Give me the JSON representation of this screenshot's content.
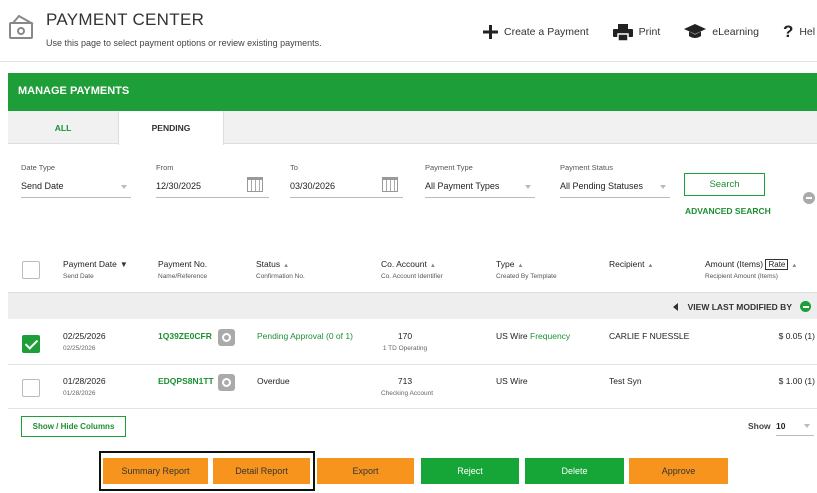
{
  "header": {
    "title": "PAYMENT CENTER",
    "subtitle": "Use this page to select payment options or review existing payments.",
    "actions": [
      {
        "label": "Create a Payment",
        "icon": "plus-icon"
      },
      {
        "label": "Print",
        "icon": "printer-icon"
      },
      {
        "label": "eLearning",
        "icon": "graduation-cap-icon"
      },
      {
        "label": "Hel",
        "icon": "help-icon"
      }
    ]
  },
  "section_title": "MANAGE PAYMENTS",
  "tabs": [
    {
      "label": "ALL",
      "active": false
    },
    {
      "label": "PENDING",
      "active": true
    }
  ],
  "filters": {
    "date_type": {
      "label": "Date Type",
      "value": "Send Date"
    },
    "from": {
      "label": "From",
      "value": "12/30/2025"
    },
    "to": {
      "label": "To",
      "value": "03/30/2026"
    },
    "payment_type": {
      "label": "Payment Type",
      "value": "All Payment Types"
    },
    "payment_status": {
      "label": "Payment Status",
      "value": "All Pending Statuses"
    },
    "search_label": "Search",
    "advanced_search": "ADVANCED SEARCH"
  },
  "columns": [
    {
      "title": "Payment Date",
      "sub": "Send Date",
      "sort": "down"
    },
    {
      "title": "Payment No.",
      "sub": "Name/Reference",
      "sort": ""
    },
    {
      "title": "Status",
      "sub": "Confirmation No.",
      "sort": "up"
    },
    {
      "title": "Co. Account",
      "sub": "Co. Account Identifier",
      "sort": "up"
    },
    {
      "title": "Type",
      "sub": "Created By Template",
      "sort": "up"
    },
    {
      "title": "Recipient",
      "sub": "",
      "sort": "up"
    },
    {
      "title": "Amount (Items)",
      "sub": "Recipient Amount (Items)",
      "sort": "up",
      "extra": "Rate"
    }
  ],
  "view_last_modified": "VIEW LAST MODIFIED BY",
  "rows": [
    {
      "checked": true,
      "date": "02/25/2026",
      "date_sub": "02/25/2026",
      "payment_no": "1Q39ZE0CFR",
      "status": "Pending Approval (0 of 1)",
      "account": "170",
      "account_sub": "1 TD Operating",
      "type": "US Wire",
      "type_link": "Frequency",
      "recipient": "CARLIE F NUESSLE",
      "amount": "$ 0.05 (1)"
    },
    {
      "checked": false,
      "date": "01/28/2026",
      "date_sub": "01/28/2026",
      "payment_no": "EDQPS8N1TT",
      "status": "Overdue",
      "account": "713",
      "account_sub": "Checking Account",
      "type": "US Wire",
      "type_link": "",
      "recipient": "Test Syn",
      "amount": "$ 1.00 (1)"
    }
  ],
  "show_hide_columns": "Show / Hide Columns",
  "page_size": {
    "label": "Show",
    "value": "10"
  },
  "buttons": [
    {
      "label": "Summary Report",
      "color": "#f7941d"
    },
    {
      "label": "Detail Report",
      "color": "#f7941d"
    },
    {
      "label": "Export",
      "color": "#f7941d"
    },
    {
      "label": "Reject",
      "color": "#16a637"
    },
    {
      "label": "Delete",
      "color": "#16a637"
    },
    {
      "label": "Approve",
      "color": "#f7941d"
    }
  ]
}
